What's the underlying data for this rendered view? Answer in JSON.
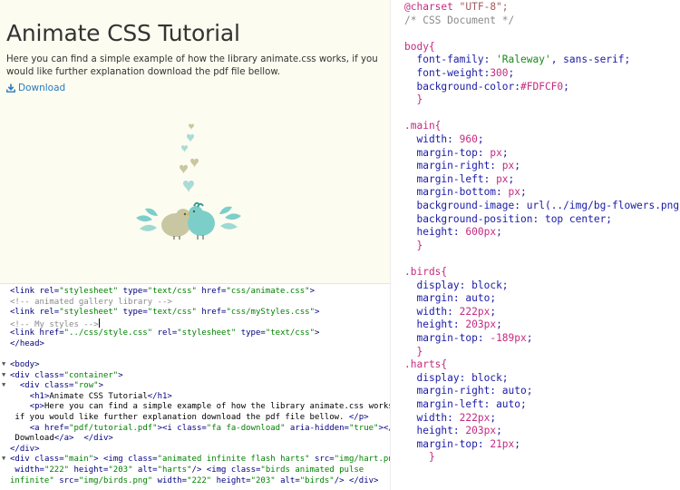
{
  "preview": {
    "title": "Animate CSS Tutorial",
    "paragraph": "Here you can find a simple example of how the library animate.css works, if you would like further explanation download the pdf file bellow.",
    "download_label": "Download",
    "colors": {
      "background": "#FDFCF0",
      "link": "#2a7bbf",
      "heart": "#a9dcd6",
      "bird_teal": "#7ccfc9",
      "bird_olive": "#c9c7a1"
    }
  },
  "html_editor": {
    "line1": "<link rel=\"stylesheet\" type=\"text/css\" href=\"css/animate.css\">",
    "line2": "<!-- animated gallery library -->",
    "line3": "<link rel=\"stylesheet\" type=\"text/css\" href=\"css/myStyles.css\">",
    "line4": "<!-- My styles -->",
    "line5": "<link href=\"../css/style.css\" rel=\"stylesheet\" type=\"text/css\">",
    "line6": "</head>",
    "line7": "<body>",
    "line8": "<div class=\"container\">",
    "line9": "  <div class=\"row\">",
    "line10": "    <h1>Animate CSS Tutorial</h1>",
    "line11": "    <p>Here you can find a simple example of how the library animate.css works,",
    "line12": " if you would like further explanation download the pdf file bellow. </p>",
    "line13": "    <a href=\"pdf/tutorial.pdf\"><i class=\"fa fa-download\" aria-hidden=\"true\"></i>",
    "line14": " Download</a>  </div>",
    "line15": "</div>",
    "line16": "<div class=\"main\"> <img class=\"animated infinite flash harts\" src=\"img/hart.png\"",
    "line17": " width=\"222\" height=\"203\" alt=\"harts\"/> <img class=\"birds animated pulse",
    "line18": "infinite\" src=\"img/birds.png\" width=\"222\" height=\"203\" alt=\"birds\"/> </div>"
  },
  "css_editor": {
    "charset_kw": "@charset",
    "charset_val": "\"UTF-8\";",
    "comment": "/* CSS Document */",
    "body_sel": "body{",
    "body_ff_prop": "font-family:",
    "body_ff_str": "'Raleway'",
    "body_ff_rest": ", sans-serif;",
    "body_fw_prop": "font-weight:",
    "body_fw_val": "300",
    "body_fw_end": ";",
    "body_bg_prop": "background-color:",
    "body_bg_val": "#FDFCF0",
    "body_bg_end": ";",
    "close": "}",
    "main_sel": ".main{",
    "main_width_prop": "width:",
    "main_width_val": "960",
    "main_width_end": ";",
    "main_mt_prop": "margin-top:",
    "main_mt_val": "px",
    "main_mt_end": ";",
    "main_mr_prop": "margin-right:",
    "main_mr_val": "px",
    "main_mr_end": ";",
    "main_ml_prop": "margin-left:",
    "main_ml_val": "px",
    "main_ml_end": ";",
    "main_mb_prop": "margin-bottom:",
    "main_mb_val": "px",
    "main_mb_end": ";",
    "main_bgi_prop": "background-image:",
    "main_bgi_val": "url(../img/bg-flowers.png);",
    "main_bgp_prop": "background-position:",
    "main_bgp_val": "top center;",
    "main_h_prop": "height:",
    "main_h_val": "600px",
    "main_h_end": ";",
    "birds_sel": ".birds{",
    "birds_d_prop": "display:",
    "birds_d_val": "block;",
    "birds_m_prop": "margin:",
    "birds_m_val": "auto;",
    "birds_w_prop": "width:",
    "birds_w_val": "222px",
    "birds_w_end": ";",
    "birds_h_prop": "height:",
    "birds_h_val": "203px",
    "birds_h_end": ";",
    "birds_mt_prop": "margin-top:",
    "birds_mt_val": "-189px",
    "birds_mt_end": ";",
    "harts_sel": ".harts{",
    "harts_d_prop": "display:",
    "harts_d_val": "block;",
    "harts_mr_prop": "margin-right:",
    "harts_mr_val": "auto;",
    "harts_ml_prop": "margin-left:",
    "harts_ml_val": "auto;",
    "harts_w_prop": "width:",
    "harts_w_val": "222px",
    "harts_w_end": ";",
    "harts_h_prop": "height:",
    "harts_h_val": "203px",
    "harts_h_end": ";",
    "harts_mt_prop": "margin-top:",
    "harts_mt_val": "21px",
    "harts_mt_end": ";"
  }
}
